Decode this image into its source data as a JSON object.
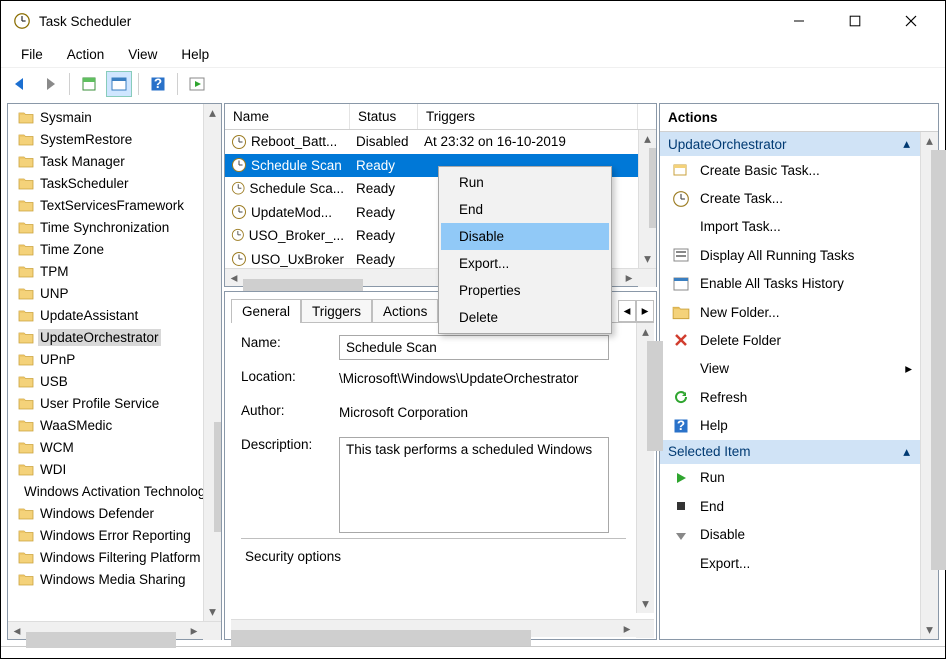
{
  "window": {
    "title": "Task Scheduler"
  },
  "menu": {
    "file": "File",
    "action": "Action",
    "view": "View",
    "help": "Help"
  },
  "tree": {
    "items": [
      {
        "label": "Sysmain"
      },
      {
        "label": "SystemRestore"
      },
      {
        "label": "Task Manager"
      },
      {
        "label": "TaskScheduler"
      },
      {
        "label": "TextServicesFramework"
      },
      {
        "label": "Time Synchronization"
      },
      {
        "label": "Time Zone"
      },
      {
        "label": "TPM"
      },
      {
        "label": "UNP"
      },
      {
        "label": "UpdateAssistant"
      },
      {
        "label": "UpdateOrchestrator",
        "selected": true
      },
      {
        "label": "UPnP"
      },
      {
        "label": "USB"
      },
      {
        "label": "User Profile Service"
      },
      {
        "label": "WaaSMedic"
      },
      {
        "label": "WCM"
      },
      {
        "label": "WDI"
      },
      {
        "label": "Windows Activation Technologies"
      },
      {
        "label": "Windows Defender"
      },
      {
        "label": "Windows Error Reporting"
      },
      {
        "label": "Windows Filtering Platform"
      },
      {
        "label": "Windows Media Sharing"
      }
    ]
  },
  "list": {
    "cols": {
      "name": "Name",
      "status": "Status",
      "triggers": "Triggers"
    },
    "rows": [
      {
        "name": "Reboot_Batt...",
        "status": "Disabled",
        "trigger": "At 23:32 on 16-10-2019"
      },
      {
        "name": "Schedule Scan",
        "status": "Ready",
        "trigger": "",
        "selected": true
      },
      {
        "name": "Schedule Sca...",
        "status": "Ready",
        "trigger": ""
      },
      {
        "name": "UpdateMod...",
        "status": "Ready",
        "trigger": ""
      },
      {
        "name": "USO_Broker_...",
        "status": "Ready",
        "trigger": ""
      },
      {
        "name": "USO_UxBroker",
        "status": "Ready",
        "trigger": ""
      }
    ]
  },
  "ctx": {
    "items": [
      "Run",
      "End",
      "Disable",
      "Export...",
      "Properties",
      "Delete"
    ],
    "hover_index": 2
  },
  "tabs": [
    "General",
    "Triggers",
    "Actions"
  ],
  "details": {
    "name_lbl": "Name:",
    "name_val": "Schedule Scan",
    "loc_lbl": "Location:",
    "loc_val": "\\Microsoft\\Windows\\UpdateOrchestrator",
    "auth_lbl": "Author:",
    "auth_val": "Microsoft Corporation",
    "desc_lbl": "Description:",
    "desc_val": "This task performs a scheduled Windows",
    "sec_opts": "Security options"
  },
  "actions": {
    "header": "Actions",
    "group1": "UpdateOrchestrator",
    "group1_items": [
      "Create Basic Task...",
      "Create Task...",
      "Import Task...",
      "Display All Running Tasks",
      "Enable All Tasks History",
      "New Folder...",
      "Delete Folder",
      "View",
      "Refresh",
      "Help"
    ],
    "group2": "Selected Item",
    "group2_items": [
      "Run",
      "End",
      "Disable",
      "Export..."
    ]
  }
}
